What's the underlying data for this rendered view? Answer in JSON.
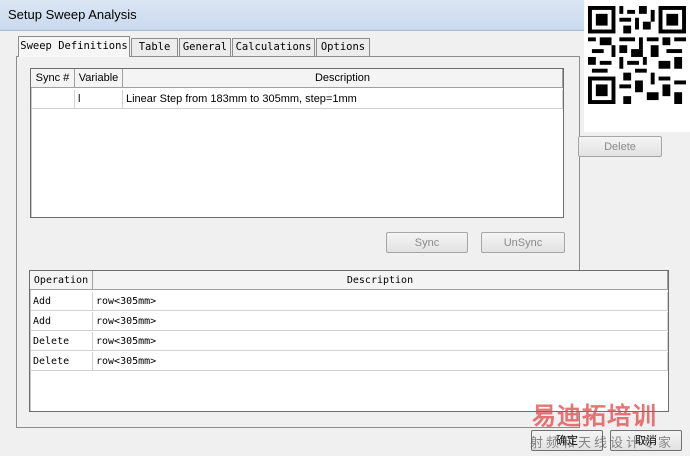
{
  "window": {
    "title": "Setup Sweep Analysis"
  },
  "tabs": [
    {
      "label": "Sweep Definitions"
    },
    {
      "label": "Table"
    },
    {
      "label": "General"
    },
    {
      "label": "Calculations"
    },
    {
      "label": "Options"
    }
  ],
  "sweep_table": {
    "headers": [
      "Sync #",
      "Variable",
      "Description"
    ],
    "rows": [
      {
        "sync": "",
        "variable": "l",
        "description": "Linear Step from 183mm to 305mm, step=1mm"
      }
    ]
  },
  "side_buttons": {
    "delete": "Delete"
  },
  "sync_buttons": {
    "sync": "Sync",
    "unsync": "UnSync"
  },
  "ops_table": {
    "headers": [
      "Operation",
      "Description"
    ],
    "rows": [
      {
        "operation": "Add",
        "description": "row<305mm>"
      },
      {
        "operation": "Add",
        "description": "row<305mm>"
      },
      {
        "operation": "Delete",
        "description": "row<305mm>"
      },
      {
        "operation": "Delete",
        "description": "row<305mm>"
      }
    ]
  },
  "footer": {
    "ok": "确定",
    "cancel": "取消"
  },
  "watermark": {
    "line1": "易迪拓培训",
    "line2": "射频和天线设计专家"
  }
}
